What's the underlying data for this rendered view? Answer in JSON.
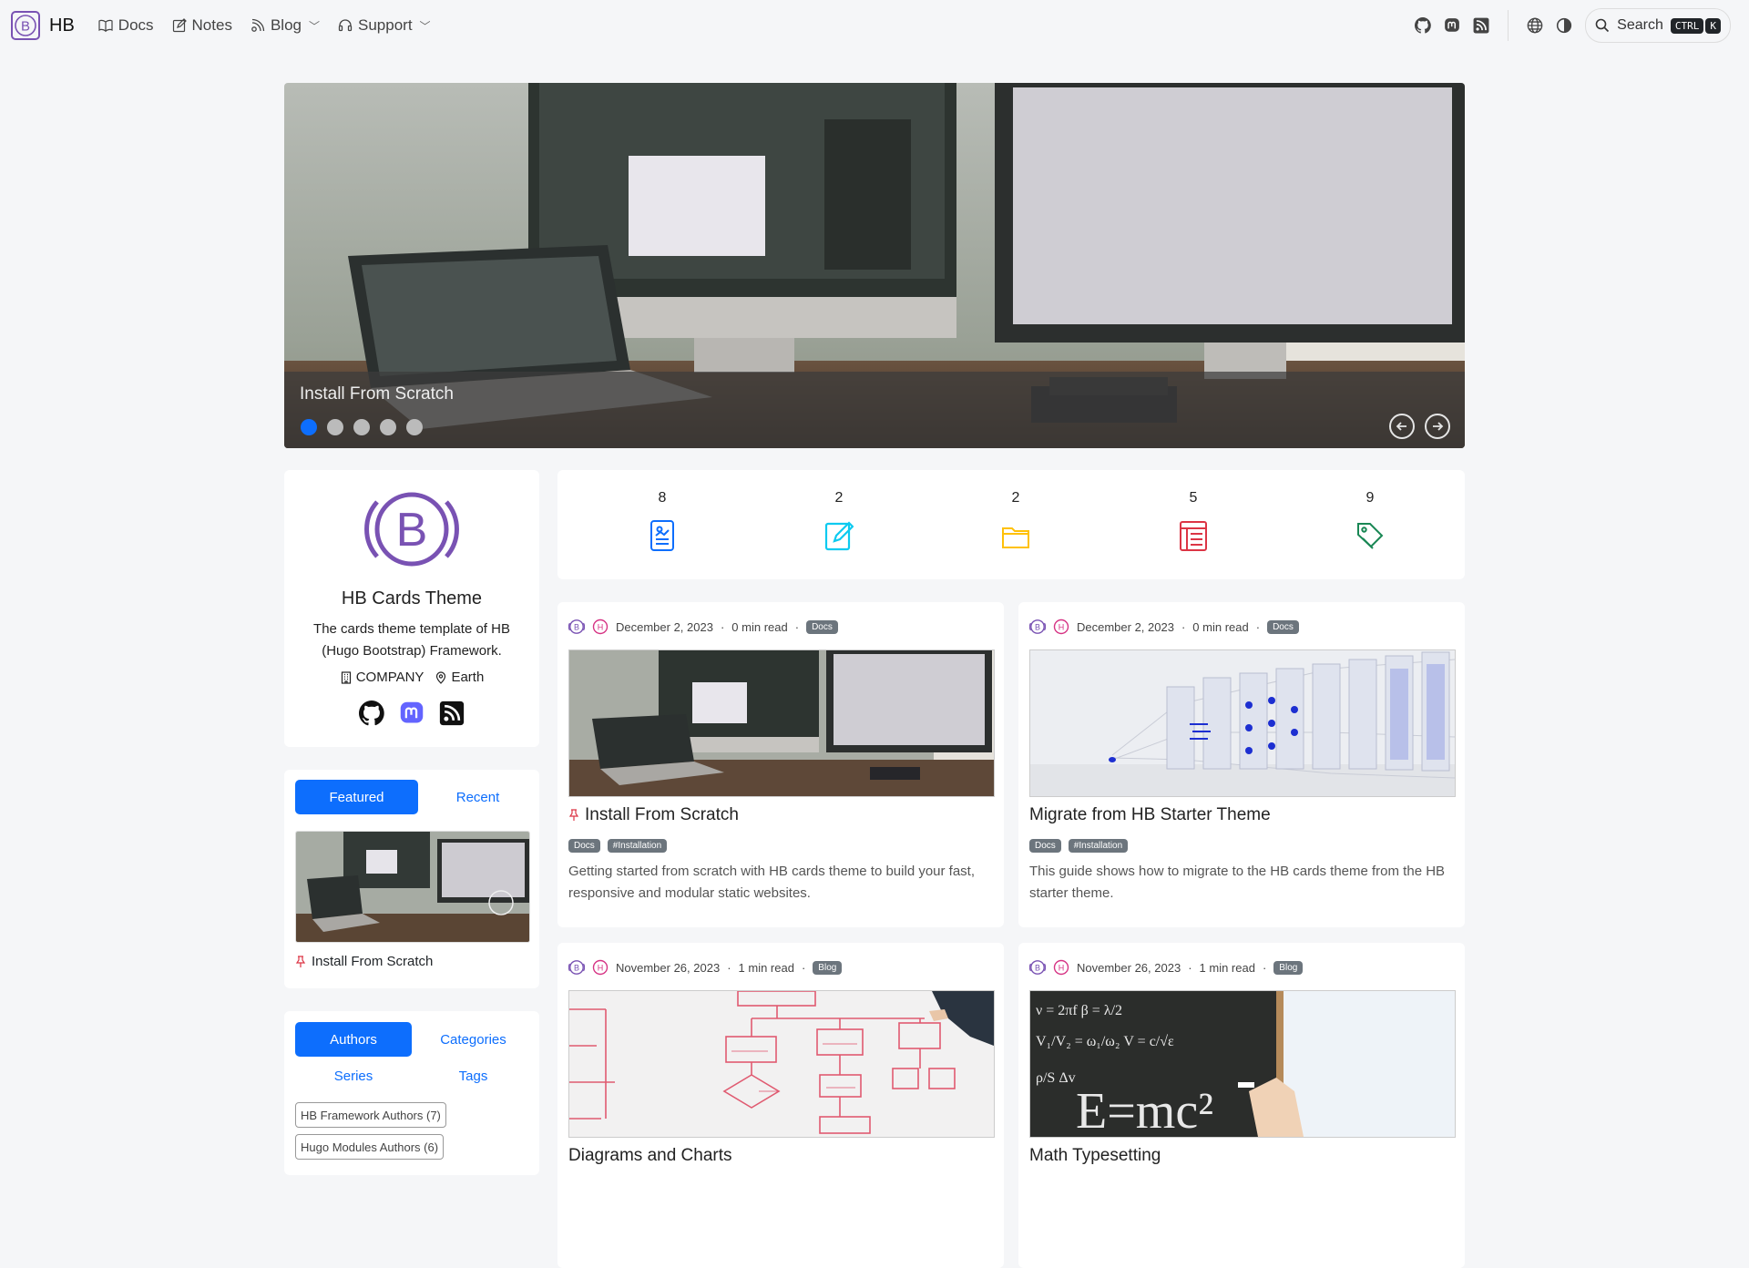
{
  "nav": {
    "brand": "HB",
    "links": [
      {
        "label": "Docs",
        "icon": "book-icon"
      },
      {
        "label": "Notes",
        "icon": "note-icon"
      },
      {
        "label": "Blog",
        "icon": "megaphone-icon",
        "dropdown": true
      },
      {
        "label": "Support",
        "icon": "headset-icon",
        "dropdown": true
      }
    ],
    "search_label": "Search",
    "kbd": [
      "CTRL",
      "K"
    ]
  },
  "hero": {
    "caption": "Install From Scratch",
    "slide_count": 5,
    "active_index": 0
  },
  "profile": {
    "name": "HB Cards Theme",
    "description": "The cards theme template of HB (Hugo Bootstrap) Framework.",
    "company": "COMPANY",
    "location": "Earth"
  },
  "stats": [
    {
      "count": "8",
      "icon": "docs-icon",
      "color": "#0d6efd"
    },
    {
      "count": "2",
      "icon": "notes-icon",
      "color": "#0dcaf0"
    },
    {
      "count": "2",
      "icon": "folder-icon",
      "color": "#ffc107"
    },
    {
      "count": "5",
      "icon": "series-icon",
      "color": "#dc3545"
    },
    {
      "count": "9",
      "icon": "tag-icon",
      "color": "#198754"
    }
  ],
  "featured": {
    "tabs": [
      "Featured",
      "Recent"
    ],
    "item_title": "Install From Scratch"
  },
  "taxonomies": {
    "tabs": [
      "Authors",
      "Categories",
      "Series",
      "Tags"
    ],
    "authors": [
      "HB Framework Authors (7)",
      "Hugo Modules Authors (6)"
    ]
  },
  "posts": [
    {
      "date": "December 2, 2023",
      "read": "0 min read",
      "category": "Docs",
      "title": "Install From Scratch",
      "pinned": true,
      "tags": [
        "Docs",
        "#Installation"
      ],
      "excerpt": "Getting started from scratch with HB cards theme to build your fast, responsive and modular static websites."
    },
    {
      "date": "December 2, 2023",
      "read": "0 min read",
      "category": "Docs",
      "title": "Migrate from HB Starter Theme",
      "pinned": false,
      "tags": [
        "Docs",
        "#Installation"
      ],
      "excerpt": "This guide shows how to migrate to the HB cards theme from the HB starter theme."
    },
    {
      "date": "November 26, 2023",
      "read": "1 min read",
      "category": "Blog",
      "title": "Diagrams and Charts",
      "pinned": false,
      "tags": [],
      "excerpt": ""
    },
    {
      "date": "November 26, 2023",
      "read": "1 min read",
      "category": "Blog",
      "title": "Math Typesetting",
      "pinned": false,
      "tags": [],
      "excerpt": ""
    }
  ],
  "colors": {
    "primary": "#0d6efd",
    "brand_purple": "#7952b3",
    "author_pink": "#d63384"
  }
}
